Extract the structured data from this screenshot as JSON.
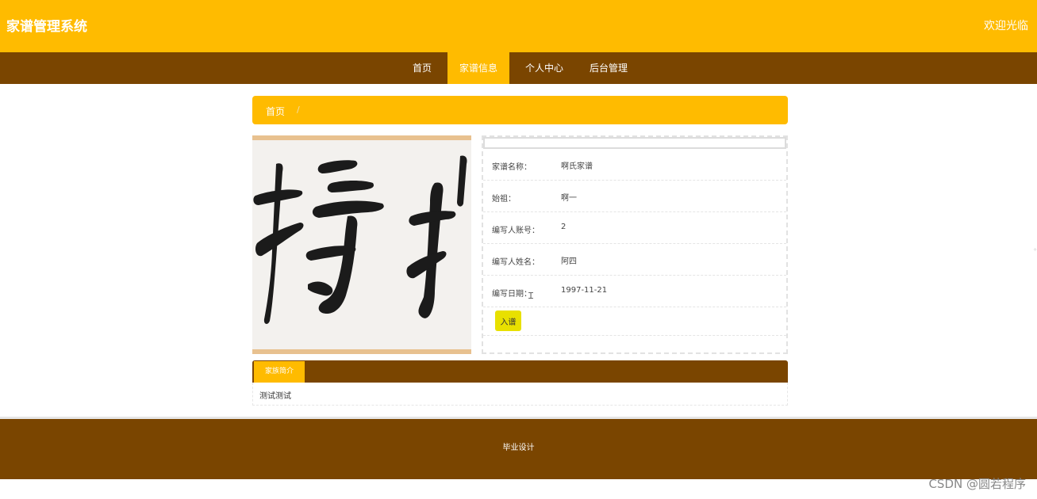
{
  "header": {
    "title": "家谱管理系统",
    "welcome": "欢迎光临"
  },
  "nav": {
    "items": [
      {
        "label": "首页"
      },
      {
        "label": "家谱信息"
      },
      {
        "label": "个人中心"
      },
      {
        "label": "后台管理"
      }
    ],
    "active": "家谱信息"
  },
  "breadcrumb": {
    "home": "首页",
    "separator": "/"
  },
  "detail": {
    "fields": [
      {
        "label": "家谱名称：",
        "value": "啊氏家谱"
      },
      {
        "label": "始祖：",
        "value": "啊一"
      },
      {
        "label": "编写人账号：",
        "value": "2"
      },
      {
        "label": "编写人姓名：",
        "value": "阿四"
      },
      {
        "label": "编写日期：",
        "value": "1997-11-21"
      }
    ],
    "join_button": "入谱"
  },
  "intro": {
    "tab_label": "家族简介",
    "text": "测试测试"
  },
  "footer": {
    "text": "毕业设计"
  },
  "watermark": "CSDN @圆若程序",
  "colors": {
    "accent": "#ffbb00",
    "brown": "#7a4500",
    "button": "#e8e000"
  }
}
